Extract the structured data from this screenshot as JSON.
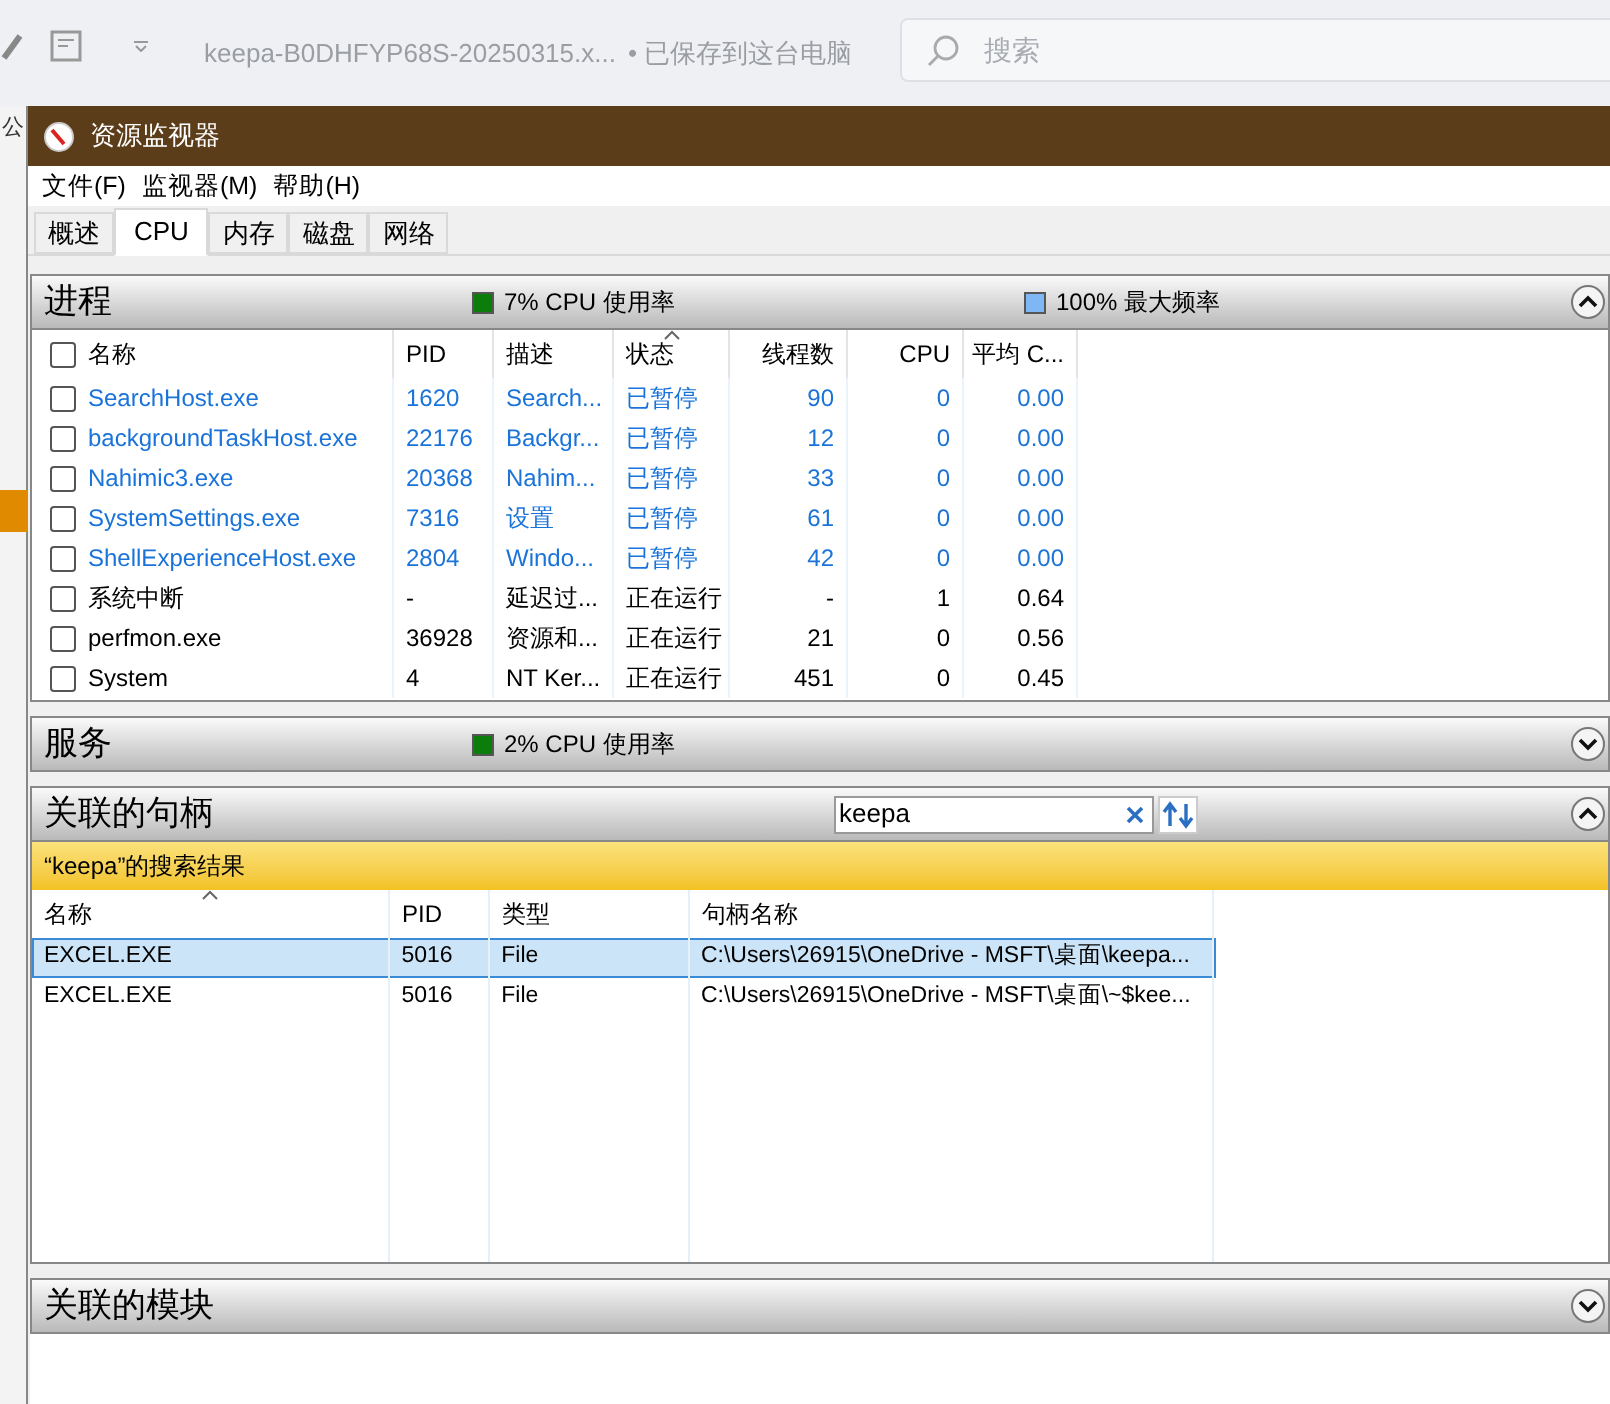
{
  "background_app": {
    "document_title": "keepa-B0DHFYP68S-20250315.x...",
    "save_status": "• 已保存到这台电脑",
    "search": {
      "placeholder": "搜索"
    },
    "side_text": "公"
  },
  "window": {
    "title": "资源监视器"
  },
  "menu": [
    "文件(F)",
    "监视器(M)",
    "帮助(H)"
  ],
  "tabs": [
    {
      "label": "概述",
      "selected": false
    },
    {
      "label": "CPU",
      "selected": true
    },
    {
      "label": "内存",
      "selected": false
    },
    {
      "label": "磁盘",
      "selected": false
    },
    {
      "label": "网络",
      "selected": false
    }
  ],
  "processes": {
    "title": "进程",
    "expanded": true,
    "all_checked": false,
    "usage": "7% CPU 使用率",
    "frequency": "100% 最大频率",
    "columns": [
      {
        "label": "名称",
        "sorted": false
      },
      {
        "label": "PID",
        "sorted": false
      },
      {
        "label": "描述",
        "sorted": false
      },
      {
        "label": "状态",
        "sorted": true
      },
      {
        "label": "线程数",
        "sorted": false
      },
      {
        "label": "CPU",
        "sorted": false
      },
      {
        "label": "平均 C...",
        "sorted": false
      }
    ],
    "rows": [
      {
        "checked": false,
        "suspended": true,
        "cells": [
          "SearchHost.exe",
          "1620",
          "Search...",
          "已暂停",
          "90",
          "0",
          "0.00"
        ]
      },
      {
        "checked": false,
        "suspended": true,
        "cells": [
          "backgroundTaskHost.exe",
          "22176",
          "Backgr...",
          "已暂停",
          "12",
          "0",
          "0.00"
        ]
      },
      {
        "checked": false,
        "suspended": true,
        "cells": [
          "Nahimic3.exe",
          "20368",
          "Nahim...",
          "已暂停",
          "33",
          "0",
          "0.00"
        ]
      },
      {
        "checked": false,
        "suspended": true,
        "cells": [
          "SystemSettings.exe",
          "7316",
          "设置",
          "已暂停",
          "61",
          "0",
          "0.00"
        ]
      },
      {
        "checked": false,
        "suspended": true,
        "cells": [
          "ShellExperienceHost.exe",
          "2804",
          "Windo...",
          "已暂停",
          "42",
          "0",
          "0.00"
        ]
      },
      {
        "checked": false,
        "suspended": false,
        "cells": [
          "系统中断",
          "-",
          "延迟过...",
          "正在运行",
          "-",
          "1",
          "0.64"
        ]
      },
      {
        "checked": false,
        "suspended": false,
        "cells": [
          "perfmon.exe",
          "36928",
          "资源和...",
          "正在运行",
          "21",
          "0",
          "0.56"
        ]
      },
      {
        "checked": false,
        "suspended": false,
        "cells": [
          "System",
          "4",
          "NT Ker...",
          "正在运行",
          "451",
          "0",
          "0.45"
        ]
      }
    ]
  },
  "services": {
    "title": "服务",
    "expanded": false,
    "usage": "2% CPU 使用率"
  },
  "handles": {
    "title": "关联的句柄",
    "expanded": true,
    "search": {
      "value": "keepa"
    },
    "results_label": "“keepa”的搜索结果",
    "columns": [
      {
        "label": "名称",
        "sorted": true
      },
      {
        "label": "PID",
        "sorted": false
      },
      {
        "label": "类型",
        "sorted": false
      },
      {
        "label": "句柄名称",
        "sorted": false
      }
    ],
    "rows": [
      {
        "selected": true,
        "cells": [
          "EXCEL.EXE",
          "5016",
          "File",
          "C:\\Users\\26915\\OneDrive - MSFT\\桌面\\keepa..."
        ]
      },
      {
        "selected": false,
        "cells": [
          "EXCEL.EXE",
          "5016",
          "File",
          "C:\\Users\\26915\\OneDrive - MSFT\\桌面\\~$kee..."
        ]
      }
    ]
  },
  "modules": {
    "title": "关联的模块",
    "expanded": false
  }
}
